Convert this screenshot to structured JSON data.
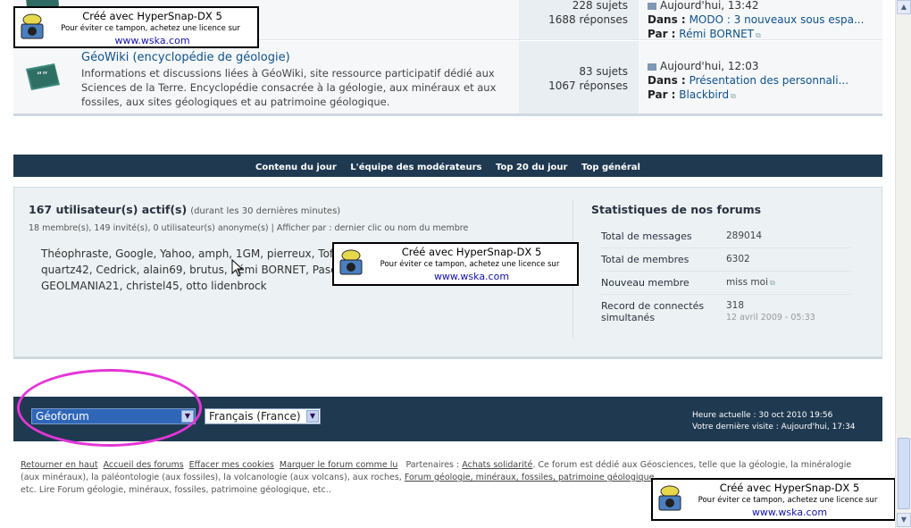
{
  "forums": {
    "top_row": {
      "topics": "228 sujets",
      "replies": "1688 réponses",
      "last_date": "Aujourd'hui, 13:42",
      "in_label": "Dans :",
      "in_value": "MODO : 3 nouveaux sous espa...",
      "by_label": "Par :",
      "by_value": "Rémi BORNET"
    },
    "geowiki": {
      "title": "GéoWiki (encyclopédie de géologie)",
      "description": "Informations et discussions liées à GéoWiki, site ressource participatif dédié aux Sciences de la Terre. Encyclopédie consacrée à la géologie, aux minéraux et aux fossiles, aux sites géologiques et au patrimoine géologique.",
      "topics": "83 sujets",
      "replies": "1067 réponses",
      "last_date": "Aujourd'hui, 12:03",
      "in_label": "Dans :",
      "in_value": "Présentation des personnali...",
      "by_label": "Par :",
      "by_value": "Blackbird"
    }
  },
  "navbar": {
    "items": [
      "Contenu du jour",
      "L'équipe des modérateurs",
      "Top 20 du jour",
      "Top général"
    ]
  },
  "online": {
    "title": "167 utilisateur(s) actif(s)",
    "title_note": "(durant les 30 dernières minutes)",
    "subtitle": "18 membre(s), 149 invité(s), 0 utilisateur(s) anonyme(s) | Afficher par : dernier clic ou nom du membre",
    "users_line1": "Théophraste, Google, Yahoo, amph, 1GM, pierreux, Tof,",
    "users_line2": "quartz42, Cedrick, alain69, brutus, Rémi BORNET, Pasc",
    "users_line3": "GEOLMANIA21, christel45, otto lidenbrock"
  },
  "stats": {
    "title": "Statistiques de nos forums",
    "rows": [
      {
        "label": "Total de messages",
        "value": "289014",
        "sub": ""
      },
      {
        "label": "Total de membres",
        "value": "6302",
        "sub": ""
      },
      {
        "label": "Nouveau membre",
        "value": "miss moi",
        "sub": ""
      },
      {
        "label": "Record de connectés simultanés",
        "value": "318",
        "sub": "12 avril 2009 - 05:33"
      }
    ]
  },
  "footbar": {
    "forum_select": "Géoforum",
    "lang_select": "Français (France)",
    "current_time": "Heure actuelle : 30 oct 2010 19:56",
    "last_visit": "Votre dernière visite : Aujourd'hui, 17:34"
  },
  "footer": {
    "links": [
      "Retourner en haut",
      "Accueil des forums",
      "Effacer mes cookies",
      "Marquer le forum comme lu"
    ],
    "partners_label": "Partenaires :",
    "partner_link": "Achats solidarité",
    "text_1": ". Ce forum est dédié aux Géosciences, telle que la géologie, la minéralogie (aux minéraux), la paléontologie (aux fossiles), la volcanologie (aux volcans), aux roches,",
    "link_2": "Forum géologie, minéraux, fossiles, patrimoine géologique",
    "text_2": "etc. Lire Forum géologie, minéraux, fossiles, patrimoine géologique, etc.."
  },
  "watermark": {
    "line1": "Créé avec HyperSnap-DX 5",
    "line2": "Pour éviter ce tampon, achetez une licence sur",
    "line3": "www.wska.com"
  },
  "colors": {
    "navbar_bg": "#1f3951",
    "link": "#105289",
    "highlight": "#e436d6"
  }
}
